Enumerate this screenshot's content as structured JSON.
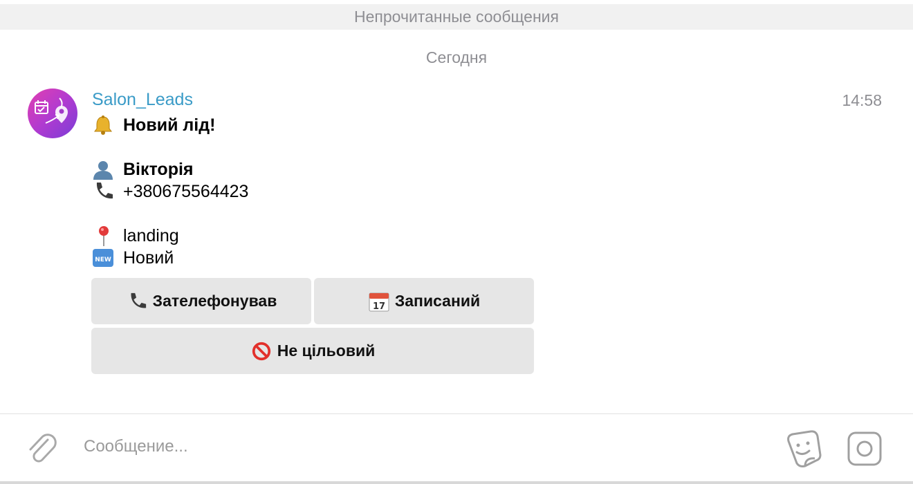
{
  "chat": {
    "unread_label": "Непрочитанные сообщения",
    "date_label": "Сегодня"
  },
  "message": {
    "sender": "Salon_Leads",
    "time": "14:58",
    "lines": [
      {
        "icon": "bell-icon",
        "text": "Новий лід!"
      },
      {
        "icon": "person-icon",
        "text": "Вікторія"
      },
      {
        "icon": "phone-icon",
        "text": "+380675564423"
      },
      {
        "icon": "pin-icon",
        "text": "landing"
      },
      {
        "icon": "new-icon",
        "text": "Новий"
      }
    ],
    "buttons": {
      "called": {
        "icon": "phone-icon",
        "label": "Зателефонував"
      },
      "booked": {
        "icon": "calendar-icon",
        "label": "Записаний"
      },
      "not_target": {
        "icon": "no-entry-icon",
        "label": "Не цільовий"
      }
    }
  },
  "composer": {
    "placeholder": "Сообщение..."
  },
  "icons": {
    "attach": "paperclip-icon",
    "sticker": "sticker-icon",
    "camera": "camera-icon"
  },
  "colors": {
    "sender": "#3a9bc7",
    "button_bg": "#e6e6e6",
    "unread_bar_bg": "#f1f1f1"
  }
}
